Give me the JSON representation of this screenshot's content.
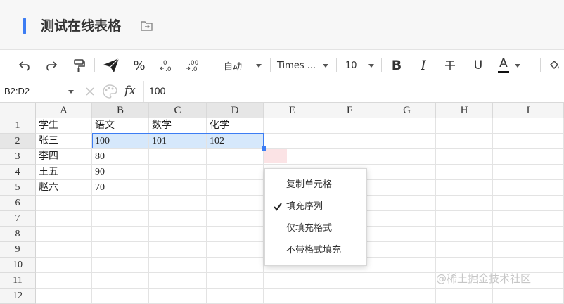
{
  "document": {
    "title": "测试在线表格"
  },
  "toolbar": {
    "font_size_auto": "自动",
    "font_family": "Times ...",
    "font_size": "10",
    "bold_label": "B",
    "italic_label": "I",
    "underline_label": "U",
    "text_color_label": "A",
    "text_color": "#111111",
    "percent_label": "%"
  },
  "formula_bar": {
    "name_box": "B2:D2",
    "fx_label": "fx",
    "value": "100"
  },
  "grid": {
    "columns": [
      "A",
      "B",
      "C",
      "D",
      "E",
      "F",
      "G",
      "H",
      "I"
    ],
    "rows": [
      "1",
      "2",
      "3",
      "4",
      "5",
      "6",
      "7",
      "8",
      "9",
      "10",
      "11",
      "12"
    ],
    "cells": [
      [
        "学生",
        "语文",
        "数学",
        "化学"
      ],
      [
        "张三",
        "100",
        "101",
        "102"
      ],
      [
        "李四",
        "80",
        "",
        ""
      ],
      [
        "王五",
        "90",
        "",
        ""
      ],
      [
        "赵六",
        "70",
        "",
        ""
      ]
    ]
  },
  "context_menu": {
    "items": [
      "复制单元格",
      "填充序列",
      "仅填充格式",
      "不带格式填充"
    ],
    "checked_index": 1
  },
  "watermark": "@稀土掘金技术社区",
  "colors": {
    "accent": "#3d7df3",
    "selection_fill": "#d6e8fb",
    "autofill_marker": "#fbe3e5"
  }
}
